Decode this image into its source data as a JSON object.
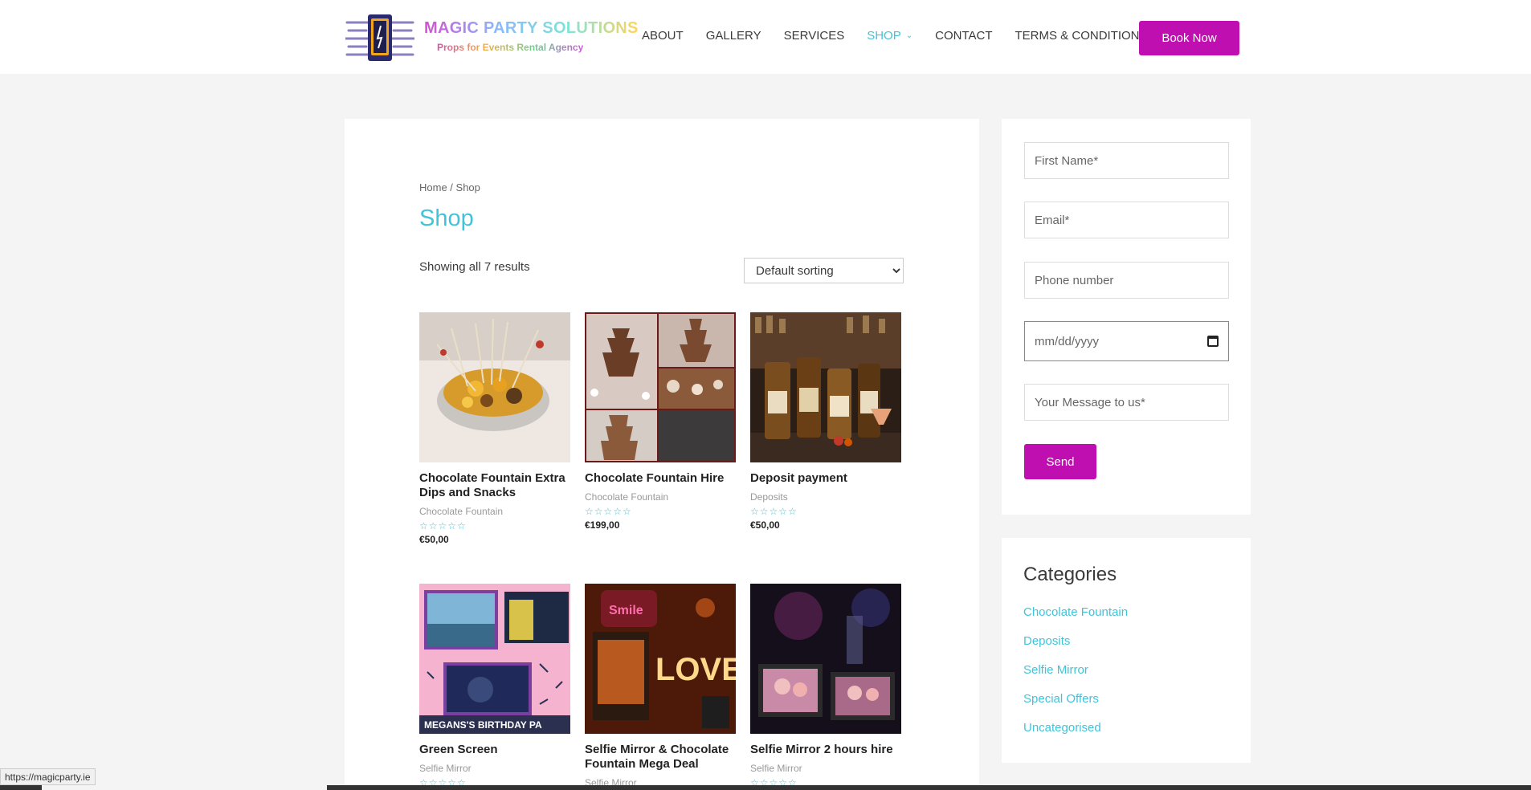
{
  "header": {
    "logo_title": "MAGIC PARTY SOLUTIONS",
    "logo_subtitle": "Props for Events Rental Agency",
    "nav": [
      {
        "label": "ABOUT",
        "active": false
      },
      {
        "label": "GALLERY",
        "active": false
      },
      {
        "label": "SERVICES",
        "active": false
      },
      {
        "label": "SHOP",
        "active": true
      },
      {
        "label": "CONTACT",
        "active": false
      },
      {
        "label": "TERMS & CONDITIONS",
        "active": false
      }
    ],
    "book_button": "Book Now"
  },
  "main": {
    "breadcrumb": {
      "home": "Home",
      "sep": " / ",
      "current": "Shop"
    },
    "title": "Shop",
    "result_count": "Showing all 7 results",
    "sort_selected": "Default sorting",
    "products": [
      {
        "title": "Chocolate Fountain Extra Dips and Snacks",
        "category": "Chocolate Fountain",
        "rating": 0,
        "price": "€50,00"
      },
      {
        "title": "Chocolate Fountain Hire",
        "category": "Chocolate Fountain",
        "rating": 0,
        "price": "€199,00"
      },
      {
        "title": "Deposit payment",
        "category": "Deposits",
        "rating": 0,
        "price": "€50,00"
      },
      {
        "title": "Green Screen",
        "category": "Selfie Mirror",
        "rating": 0,
        "price": ""
      },
      {
        "title": "Selfie Mirror & Chocolate Fountain Mega Deal",
        "category": "Selfie Mirror",
        "rating": 0,
        "price": ""
      },
      {
        "title": "Selfie Mirror 2 hours hire",
        "category": "Selfie Mirror",
        "rating": 0,
        "price": ""
      }
    ],
    "image_texts": {
      "green_screen": "MEGANS'S BIRTHDAY PA",
      "mirror_love": "LOVE",
      "mirror_smile": "Smile"
    }
  },
  "sidebar": {
    "form": {
      "first_name_placeholder": "First Name*",
      "email_placeholder": "Email*",
      "phone_placeholder": "Phone number",
      "date_placeholder": "mm/dd/yyyy",
      "message_placeholder": "Your Message to us*",
      "send_label": "Send"
    },
    "categories": {
      "title": "Categories",
      "items": [
        "Chocolate Fountain",
        "Deposits",
        "Selfie Mirror",
        "Special Offers",
        "Uncategorised"
      ]
    }
  },
  "status": {
    "url": "https://magicparty.ie"
  },
  "colors": {
    "accent": "#41c4d9",
    "brand": "#c00fb0"
  }
}
